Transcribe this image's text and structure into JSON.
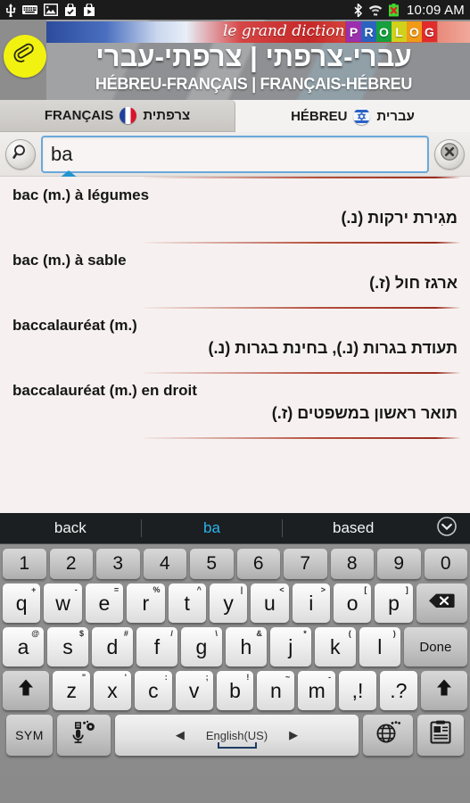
{
  "status_bar": {
    "left_icons": [
      "usb-icon",
      "keyboard-icon",
      "image-icon",
      "checkbox-bag-icon",
      "play-store-icon"
    ],
    "right_icons": [
      "bluetooth-icon",
      "wifi-icon",
      "battery-error-icon"
    ],
    "time": "10:09 AM"
  },
  "banner": {
    "script_title": "le grand dictionnaire",
    "brand": "PROLOG",
    "brand_letters": [
      "P",
      "R",
      "O",
      "L",
      "O",
      "G"
    ],
    "brand_colors": [
      "#9b2fae",
      "#2a63c0",
      "#16a03e",
      "#cfd11a",
      "#f09a16",
      "#e12c2c"
    ],
    "hebrew_title": "עברי-צרפתי | צרפתי-עברי",
    "french_title": "HÉBREU-FRANÇAIS | FRANÇAIS-HÉBREU",
    "clip_badge": "paperclip-icon",
    "badge_color": "#f2f211"
  },
  "tabs": [
    {
      "label": "FRANÇAIS",
      "native": "צרפתית",
      "flag": "flag-france",
      "active": false
    },
    {
      "label": "HÉBREU",
      "native": "עברית",
      "flag": "flag-israel",
      "active": true
    }
  ],
  "search": {
    "icon": "magnifier-icon",
    "value": "ba",
    "placeholder": "",
    "clear_icon": "close-circle-icon",
    "caret_handle": "text-cursor-handle"
  },
  "results": [
    {
      "french": "bac (m.) à légumes",
      "hebrew": "מגִירת ירקות (נ.)"
    },
    {
      "french": "bac (m.) à sable",
      "hebrew": "ארגז חול (ז.)"
    },
    {
      "french": "baccalauréat (m.)",
      "hebrew": "תעודת בגרות (נ.), בחינת בגרות (נ.)"
    },
    {
      "french": "baccalauréat (m.) en droit",
      "hebrew": "תואר ראשון במשפטים (ז.)"
    }
  ],
  "suggestions": {
    "items": [
      "back",
      "ba",
      "based"
    ],
    "current_index": 1,
    "expand_icon": "chevron-down-icon",
    "highlight_color": "#2cb4ea"
  },
  "keyboard": {
    "row_numbers": [
      "1",
      "2",
      "3",
      "4",
      "5",
      "6",
      "7",
      "8",
      "9",
      "0"
    ],
    "row_q": [
      {
        "key": "q",
        "alt": "+"
      },
      {
        "key": "w",
        "alt": "-"
      },
      {
        "key": "e",
        "alt": "="
      },
      {
        "key": "r",
        "alt": "%"
      },
      {
        "key": "t",
        "alt": "^"
      },
      {
        "key": "y",
        "alt": "|"
      },
      {
        "key": "u",
        "alt": "<"
      },
      {
        "key": "i",
        "alt": ">"
      },
      {
        "key": "o",
        "alt": "["
      },
      {
        "key": "p",
        "alt": "]"
      }
    ],
    "backspace": "backspace-icon",
    "row_a": [
      {
        "key": "a",
        "alt": "@"
      },
      {
        "key": "s",
        "alt": "$"
      },
      {
        "key": "d",
        "alt": "#"
      },
      {
        "key": "f",
        "alt": "/"
      },
      {
        "key": "g",
        "alt": "\\"
      },
      {
        "key": "h",
        "alt": "&"
      },
      {
        "key": "j",
        "alt": "*"
      },
      {
        "key": "k",
        "alt": "("
      },
      {
        "key": "l",
        "alt": ")"
      }
    ],
    "done_label": "Done",
    "row_z": [
      {
        "key": "z",
        "alt": "\""
      },
      {
        "key": "x",
        "alt": "'"
      },
      {
        "key": "c",
        "alt": ":"
      },
      {
        "key": "v",
        "alt": ";"
      },
      {
        "key": "b",
        "alt": "!"
      },
      {
        "key": "n",
        "alt": "~"
      },
      {
        "key": "m",
        "alt": "-"
      },
      {
        "key": ",!",
        "alt": ""
      },
      {
        "key": ".?",
        "alt": ""
      }
    ],
    "shift_icon": "shift-arrow-icon",
    "bottom": {
      "sym_label": "SYM",
      "mic_icon": "microphone-settings-icon",
      "space_label": "English(US)",
      "space_left_arrow": "◀",
      "space_right_arrow": "▶",
      "globe_icon": "globe-language-icon",
      "clipboard_icon": "clipboard-icon"
    }
  }
}
